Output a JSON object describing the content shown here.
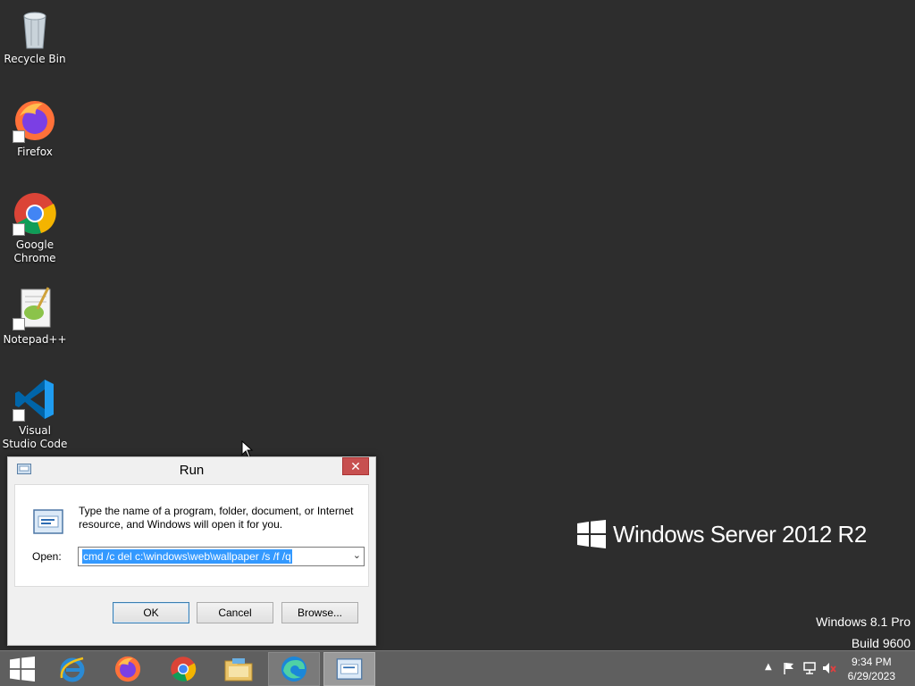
{
  "desktop": {
    "icons": [
      {
        "label": "Recycle Bin"
      },
      {
        "label": "Firefox"
      },
      {
        "label": "Google Chrome"
      },
      {
        "label": "Notepad++"
      },
      {
        "label": "Visual Studio Code"
      }
    ]
  },
  "branding": {
    "product": "Windows Server 2012 R2",
    "edition": "Windows 8.1 Pro",
    "build": "Build 9600"
  },
  "run_dialog": {
    "title": "Run",
    "close_symbol": "✕",
    "description": "Type the name of a program, folder, document, or Internet resource, and Windows will open it for you.",
    "open_label": "Open:",
    "command_value": "cmd /c del c:\\windows\\web\\wallpaper /s /f /q",
    "ok_label": "OK",
    "cancel_label": "Cancel",
    "browse_label": "Browse..."
  },
  "taskbar": {
    "items": [
      "start",
      "internet-explorer",
      "firefox",
      "chrome",
      "file-explorer",
      "edge",
      "run"
    ],
    "time": "9:34 PM",
    "date": "6/29/2023",
    "tray_icons": [
      "show-hidden-icon",
      "flag-icon",
      "network-icon",
      "volume-muted-icon"
    ]
  },
  "colors": {
    "desktop_bg": "#2d2d2d",
    "taskbar_bg": "#5f5f5f",
    "selection": "#3399ff",
    "close_button": "#c75050"
  }
}
